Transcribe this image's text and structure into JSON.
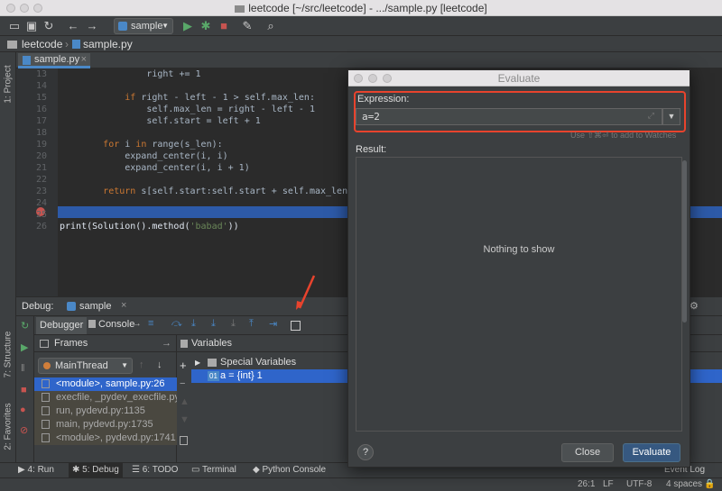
{
  "window": {
    "title": "leetcode [~/src/leetcode] - .../sample.py [leetcode]"
  },
  "toolbar": {
    "run_config": "sample"
  },
  "navbar": {
    "project": "leetcode",
    "file": "sample.py"
  },
  "editor": {
    "tab": "sample.py",
    "lines": [
      {
        "num": "13",
        "text": "                right += 1"
      },
      {
        "num": "14",
        "text": ""
      },
      {
        "num": "15",
        "text": "            if right - left - 1 > self.max_len:"
      },
      {
        "num": "16",
        "text": "                self.max_len = right - left - 1"
      },
      {
        "num": "17",
        "text": "                self.start = left + 1"
      },
      {
        "num": "18",
        "text": ""
      },
      {
        "num": "19",
        "text": "        for i in range(s_len):"
      },
      {
        "num": "20",
        "text": "            expand_center(i, i)"
      },
      {
        "num": "21",
        "text": "            expand_center(i, i + 1)"
      },
      {
        "num": "22",
        "text": ""
      },
      {
        "num": "23",
        "text": "        return s[self.start:self.start + self.max_len]"
      },
      {
        "num": "24",
        "text": ""
      },
      {
        "num": "25",
        "text": ""
      },
      {
        "num": "26",
        "text": "print(Solution().method('babad'))"
      }
    ]
  },
  "left_stripe": {
    "project": "1: Project",
    "structure": "7: Structure",
    "favorites": "2: Favorites"
  },
  "debug": {
    "label": "Debug:",
    "config": "sample",
    "tab_debugger": "Debugger",
    "tab_console": "Console",
    "frames_header": "Frames",
    "thread": "MainThread",
    "frames": [
      "<module>, sample.py:26",
      "execfile, _pydev_execfile.py",
      "run, pydevd.py:1135",
      "main, pydevd.py:1735",
      "<module>, pydevd.py:1741"
    ],
    "variables_header": "Variables",
    "variables": [
      {
        "label": "Special Variables"
      },
      {
        "label": "a = {int} 1",
        "badge": "01"
      }
    ]
  },
  "bottom_tabs": [
    "4: Run",
    "5: Debug",
    "6: TODO",
    "Terminal",
    "Python Console"
  ],
  "event_log": "Event Log",
  "status": {
    "position": "26:1",
    "line_sep": "LF",
    "encoding": "UTF-8",
    "indent": "4 spaces"
  },
  "evaluate": {
    "title": "Evaluate",
    "expression_label": "Expression:",
    "expression_value": "a=2",
    "hint": "Use ⇧⌘⏎ to add to Watches",
    "result_label": "Result:",
    "empty_text": "Nothing to show",
    "help": "?",
    "close": "Close",
    "evaluate": "Evaluate"
  },
  "colors": {
    "highlight": "#2d5aa8",
    "accent_red": "#e8432d",
    "selection": "#2f65ca",
    "primary_button": "#365880"
  }
}
